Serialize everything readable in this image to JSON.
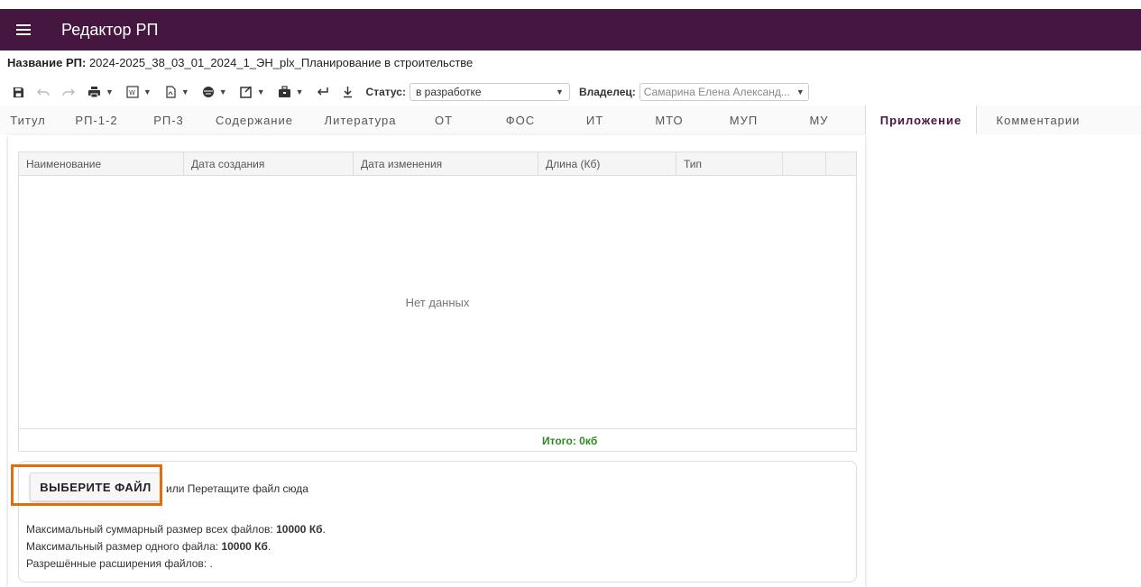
{
  "app": {
    "title": "Редактор РП"
  },
  "rp": {
    "name_label": "Название РП:",
    "name_value": "2024-2025_38_03_01_2024_1_ЭН_plx_Планирование в строительстве"
  },
  "toolbar": {
    "icons": [
      "save-icon",
      "undo-icon",
      "redo-icon",
      "print-icon",
      "word-export-icon",
      "pdf-export-icon",
      "globe-icon",
      "checkbox-icon",
      "briefcase-icon",
      "return-icon",
      "download-icon"
    ],
    "status_label": "Статус:",
    "status_value": "в разработке",
    "owner_label": "Владелец:",
    "owner_value": "Самарина Елена Александ..."
  },
  "tabs": [
    {
      "label": "Титул"
    },
    {
      "label": "РП-1-2"
    },
    {
      "label": "РП-3"
    },
    {
      "label": "Содержание"
    },
    {
      "label": "Литература"
    },
    {
      "label": "ОТ"
    },
    {
      "label": "ФОС"
    },
    {
      "label": "ИТ"
    },
    {
      "label": "МТО"
    },
    {
      "label": "МУП"
    },
    {
      "label": "МУ"
    },
    {
      "label": "Приложение"
    },
    {
      "label": "Комментарии"
    }
  ],
  "active_tab": "Приложение",
  "grid": {
    "columns": [
      "Наименование",
      "Дата создания",
      "Дата изменения",
      "Длина (Кб)",
      "Тип"
    ],
    "empty_text": "Нет данных",
    "total": "Итого: 0кб"
  },
  "upload": {
    "button_label": "ВЫБЕРИТЕ ФАЙЛ",
    "drop_text": "или Перетащите файл сюда",
    "max_total_label": "Максимальный суммарный размер всех файлов:",
    "max_total_value": "10000 Кб",
    "max_file_label": "Максимальный размер одного файла:",
    "max_file_value": "10000 Кб",
    "extensions_label": "Разрешённые расширения файлов: ."
  },
  "colors": {
    "appbar": "#45163f",
    "highlight": "#e46c0a",
    "total": "#2e8b1f"
  }
}
